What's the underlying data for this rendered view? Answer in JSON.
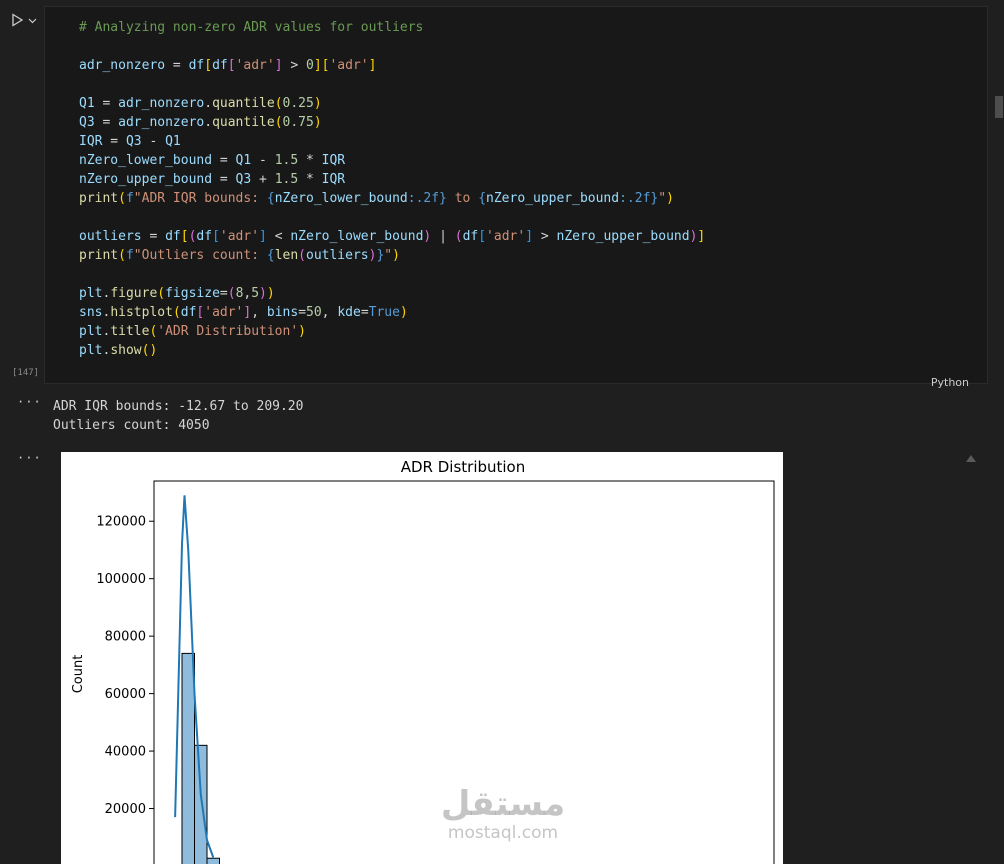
{
  "cell": {
    "execution_count": "[147]",
    "language": "Python",
    "code_lines": [
      "# Analyzing non-zero ADR values for outliers",
      "",
      "adr_nonzero = df[df['adr'] > 0]['adr']",
      "",
      "Q1 = adr_nonzero.quantile(0.25)",
      "Q3 = adr_nonzero.quantile(0.75)",
      "IQR = Q3 - Q1",
      "nZero_lower_bound = Q1 - 1.5 * IQR",
      "nZero_upper_bound = Q3 + 1.5 * IQR",
      "print(f\"ADR IQR bounds: {nZero_lower_bound:.2f} to {nZero_upper_bound:.2f}\")",
      "",
      "outliers = df[(df['adr'] < nZero_lower_bound) | (df['adr'] > nZero_upper_bound)]",
      "print(f\"Outliers count: {len(outliers)}\")",
      "",
      "plt.figure(figsize=(8,5))",
      "sns.histplot(df['adr'], bins=50, kde=True)",
      "plt.title('ADR Distribution')",
      "plt.show()"
    ]
  },
  "output": {
    "dots": "···",
    "lines": [
      "ADR IQR bounds: -12.67 to 209.20",
      "Outliers count: 4050"
    ]
  },
  "watermark": {
    "arabic": "مستقل",
    "latin": "mostaql.com"
  },
  "colors": {
    "bar_fill": "#8fbcdc",
    "kde_line": "#1f77b4",
    "background": "#1f1f1f"
  },
  "chart_data": {
    "type": "bar",
    "title": "ADR Distribution",
    "ylabel": "Count",
    "xlabel": "",
    "ylim": [
      0,
      134000
    ],
    "yticks": [
      20000,
      40000,
      60000,
      80000,
      100000,
      120000
    ],
    "ytick_labels": [
      "20000",
      "40000",
      "60000",
      "80000",
      "100000",
      "120000"
    ],
    "bins": [
      {
        "bin": 1,
        "count": 74000
      },
      {
        "bin": 2,
        "count": 42000
      },
      {
        "bin": 3,
        "count": 2700
      }
    ],
    "kde": [
      {
        "bin": 0.45,
        "count": 17000
      },
      {
        "bin": 0.7,
        "count": 60000
      },
      {
        "bin": 1.0,
        "count": 112000
      },
      {
        "bin": 1.2,
        "count": 129000
      },
      {
        "bin": 1.5,
        "count": 110000
      },
      {
        "bin": 2.0,
        "count": 60000
      },
      {
        "bin": 2.5,
        "count": 25000
      },
      {
        "bin": 3.0,
        "count": 9000
      },
      {
        "bin": 3.5,
        "count": 3000
      }
    ]
  }
}
